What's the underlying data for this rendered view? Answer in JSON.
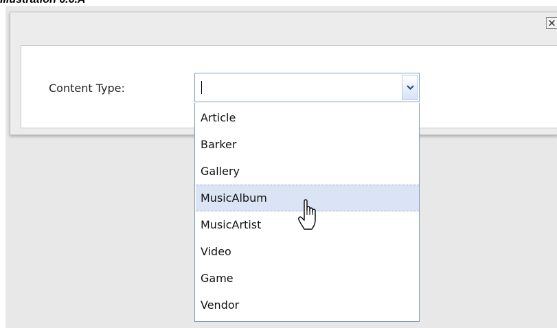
{
  "caption": "Illustration 6.6.A",
  "dialog": {
    "close_symbol": "×",
    "field_label": "Content Type:",
    "input_value": "",
    "options": [
      "Article",
      "Barker",
      "Gallery",
      "MusicAlbum",
      "MusicArtist",
      "Video",
      "Game",
      "Vendor"
    ],
    "hovered_option": "MusicAlbum"
  },
  "icons": {
    "close": "close-icon",
    "dropdown": "chevron-down-icon",
    "cursor": "hand-pointer-icon"
  },
  "colors": {
    "hover_background": "#dbe4f5",
    "combo_border": "#7f9db9",
    "chevron": "#2f4d8c"
  }
}
